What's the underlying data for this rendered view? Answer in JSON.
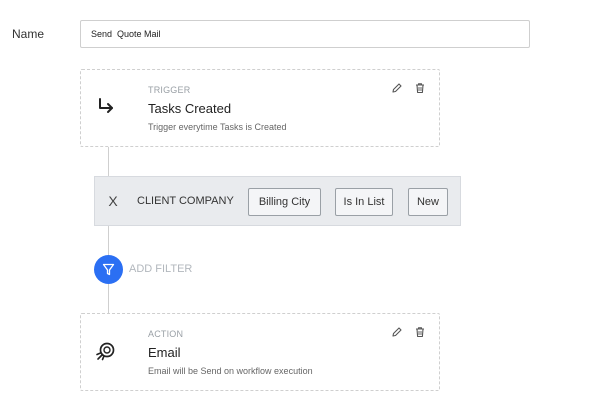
{
  "form": {
    "name_label": "Name",
    "name_value": "Send  Quote Mail"
  },
  "trigger": {
    "kind": "TRIGGER",
    "title": "Tasks Created",
    "description": "Trigger everytime Tasks is Created",
    "icon": "arrow-turn-right-icon"
  },
  "filter": {
    "remove_label": "X",
    "field": "CLIENT COMPANY",
    "attribute": "Billing City",
    "operator": "Is In List",
    "value": "New"
  },
  "add_filter": {
    "label": "ADD FILTER",
    "icon": "funnel-icon",
    "color": "#2b6ff3"
  },
  "action": {
    "kind": "ACTION",
    "title": "Email",
    "description": "Email will be Send on workflow execution",
    "icon": "email-send-icon"
  }
}
